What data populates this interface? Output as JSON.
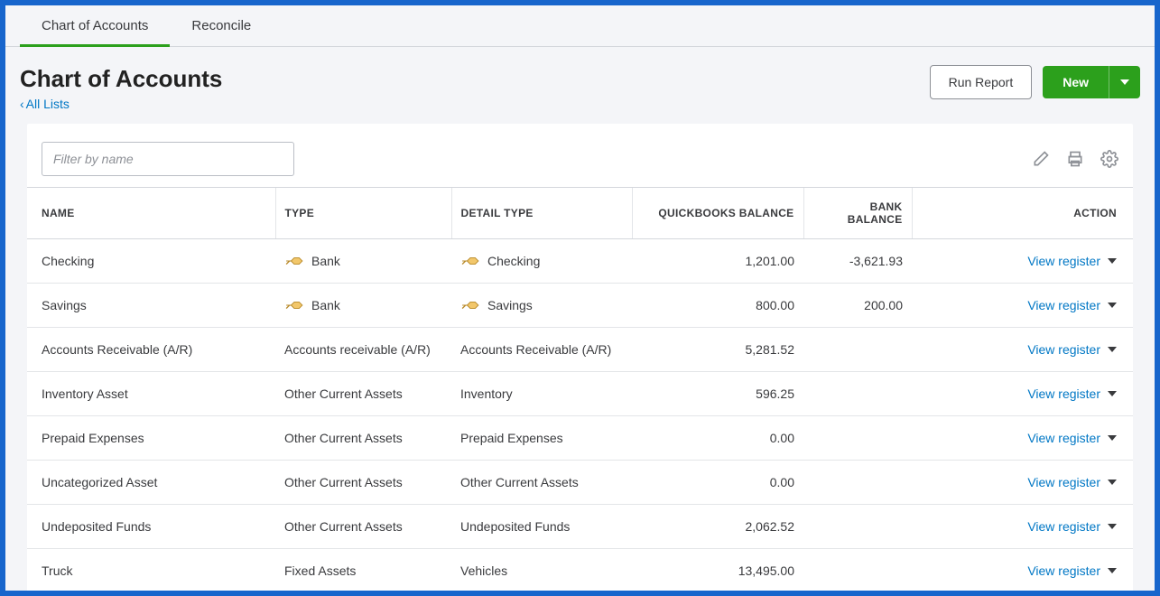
{
  "tabs": [
    {
      "label": "Chart of Accounts",
      "active": true
    },
    {
      "label": "Reconcile",
      "active": false
    }
  ],
  "page_title": "Chart of Accounts",
  "breadcrumb_text": "All Lists",
  "buttons": {
    "run_report": "Run Report",
    "new": "New"
  },
  "filter_placeholder": "Filter by name",
  "columns": {
    "name": "NAME",
    "type": "TYPE",
    "detail_type": "DETAIL TYPE",
    "qb_balance": "QUICKBOOKS BALANCE",
    "bank_balance": "BANK BALANCE",
    "action": "ACTION"
  },
  "action_label": "View register",
  "rows": [
    {
      "name": "Checking",
      "type": "Bank",
      "type_icon": true,
      "detail": "Checking",
      "detail_icon": true,
      "qb": "1,201.00",
      "bank": "-3,621.93"
    },
    {
      "name": "Savings",
      "type": "Bank",
      "type_icon": true,
      "detail": "Savings",
      "detail_icon": true,
      "qb": "800.00",
      "bank": "200.00"
    },
    {
      "name": "Accounts Receivable (A/R)",
      "type": "Accounts receivable (A/R)",
      "type_icon": false,
      "detail": "Accounts Receivable (A/R)",
      "detail_icon": false,
      "qb": "5,281.52",
      "bank": ""
    },
    {
      "name": "Inventory Asset",
      "type": "Other Current Assets",
      "type_icon": false,
      "detail": "Inventory",
      "detail_icon": false,
      "qb": "596.25",
      "bank": ""
    },
    {
      "name": "Prepaid Expenses",
      "type": "Other Current Assets",
      "type_icon": false,
      "detail": "Prepaid Expenses",
      "detail_icon": false,
      "qb": "0.00",
      "bank": ""
    },
    {
      "name": "Uncategorized Asset",
      "type": "Other Current Assets",
      "type_icon": false,
      "detail": "Other Current Assets",
      "detail_icon": false,
      "qb": "0.00",
      "bank": ""
    },
    {
      "name": "Undeposited Funds",
      "type": "Other Current Assets",
      "type_icon": false,
      "detail": "Undeposited Funds",
      "detail_icon": false,
      "qb": "2,062.52",
      "bank": ""
    },
    {
      "name": "Truck",
      "type": "Fixed Assets",
      "type_icon": false,
      "detail": "Vehicles",
      "detail_icon": false,
      "qb": "13,495.00",
      "bank": ""
    }
  ]
}
